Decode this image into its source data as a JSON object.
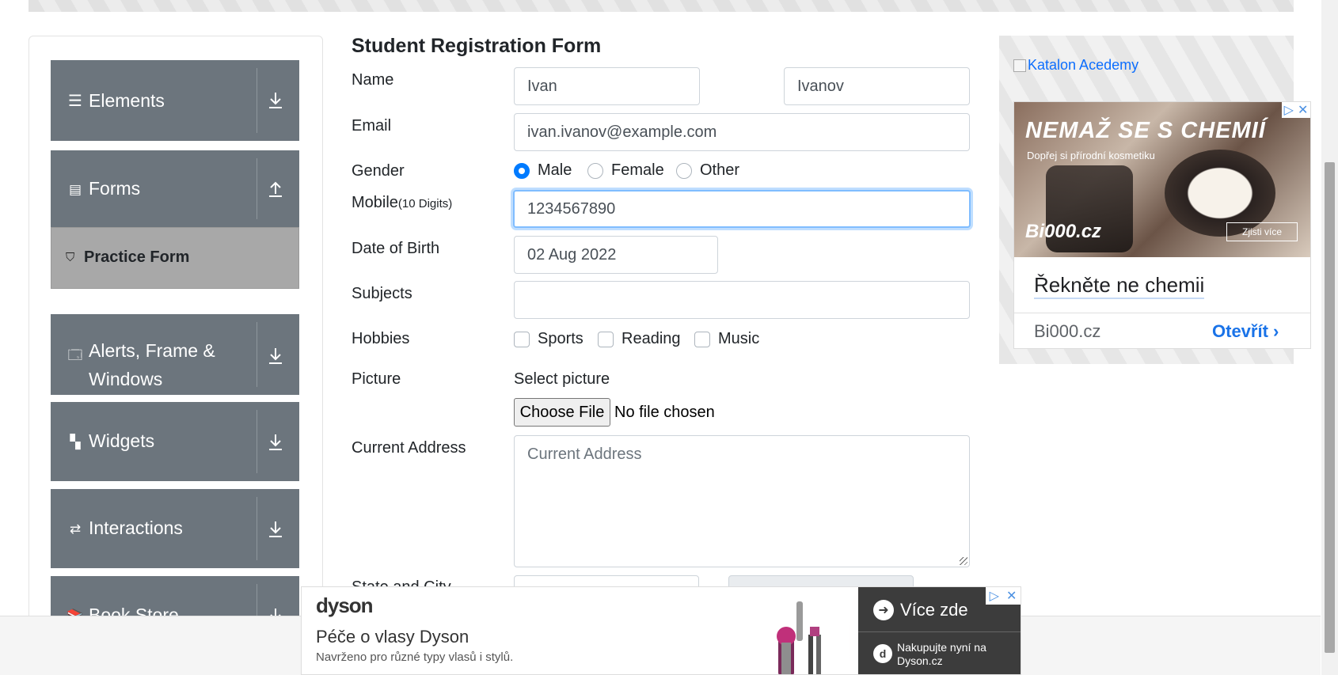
{
  "sidebar": {
    "groups": [
      {
        "label": "Elements",
        "icon": "hamburger-icon",
        "arrow": "download-arrow-icon"
      },
      {
        "label": "Forms",
        "icon": "document-icon",
        "arrow": "upload-arrow-icon"
      },
      {
        "label": "Alerts, Frame & Windows",
        "label_line1": "Alerts, Frame &",
        "label_line2": "Windows",
        "icon": "window-icon",
        "arrow": "download-arrow-icon"
      },
      {
        "label": "Widgets",
        "icon": "widgets-icon",
        "arrow": "download-arrow-icon"
      },
      {
        "label": "Interactions",
        "icon": "interactions-icon",
        "arrow": "download-arrow-icon"
      },
      {
        "label": "Book Store Application",
        "label_visible": "Book Store",
        "icon": "books-icon",
        "arrow": "download-arrow-icon"
      }
    ],
    "active_item": "Practice Form"
  },
  "form": {
    "title": "Student Registration Form",
    "name_label": "Name",
    "first_name": "Ivan",
    "last_name": "Ivanov",
    "email_label": "Email",
    "email": "ivan.ivanov@example.com",
    "gender_label": "Gender",
    "gender_options": [
      "Male",
      "Female",
      "Other"
    ],
    "gender_selected": "Male",
    "mobile_label": "Mobile",
    "mobile_hint": "(10 Digits)",
    "mobile": "1234567890",
    "dob_label": "Date of Birth",
    "dob": "02 Aug 2022",
    "subjects_label": "Subjects",
    "subjects": "",
    "hobbies_label": "Hobbies",
    "hobbies": [
      "Sports",
      "Reading",
      "Music"
    ],
    "picture_label": "Picture",
    "select_picture": "Select picture",
    "choose_file": "Choose File",
    "no_file": "No file chosen",
    "address_label": "Current Address",
    "address_placeholder": "Current Address",
    "state_city_label": "State and City"
  },
  "side_ad": {
    "image_alt": "Katalon Acedemy",
    "headline": "NEMAŽ SE S CHEMIÍ",
    "subheadline": "Dopřej si přírodní kosmetiku",
    "brand_logo": "Bi000.cz",
    "cta_small": "Zjisti více",
    "title": "Řekněte ne chemii",
    "domain": "Bi000.cz",
    "open": "Otevřít"
  },
  "bottom_ad": {
    "brand": "dyson",
    "title": "Péče o vlasy Dyson",
    "subtitle": "Navrženo pro různé typy vlasů i stylů.",
    "cta": "Více zde",
    "shop": "Nakupujte nyní na Dyson.cz"
  },
  "colors": {
    "sidebar_bg": "#6c757d",
    "active_item_bg": "#a8a8a8",
    "primary": "#007bff",
    "link": "#0d6efd"
  }
}
